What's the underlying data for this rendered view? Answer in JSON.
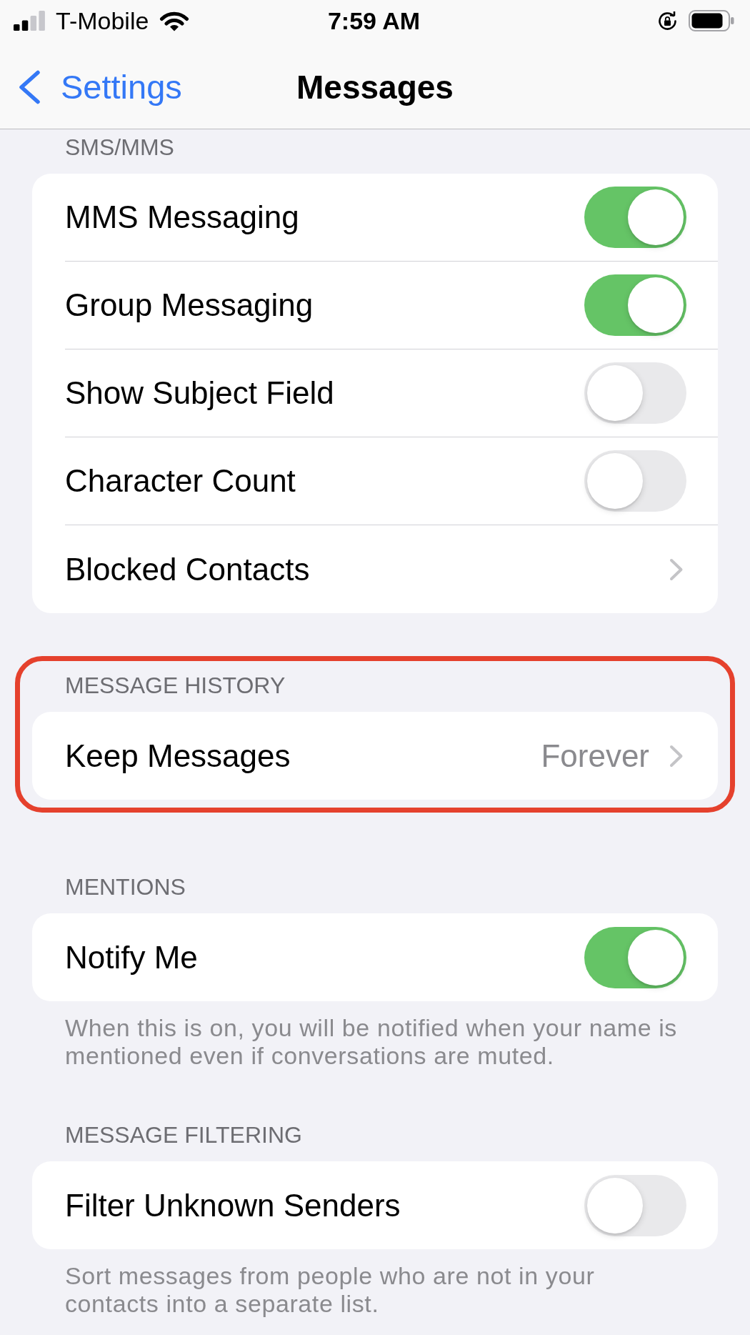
{
  "status_bar": {
    "carrier": "T-Mobile",
    "time": "7:59 AM"
  },
  "nav_bar": {
    "back_label": "Settings",
    "title": "Messages"
  },
  "sections": [
    {
      "header": "SMS/MMS",
      "highlighted": false,
      "rows": [
        {
          "kind": "toggle",
          "label": "MMS Messaging",
          "on": true
        },
        {
          "kind": "toggle",
          "label": "Group Messaging",
          "on": true
        },
        {
          "kind": "toggle",
          "label": "Show Subject Field",
          "on": false
        },
        {
          "kind": "toggle",
          "label": "Character Count",
          "on": false
        },
        {
          "kind": "link",
          "label": "Blocked Contacts"
        }
      ]
    },
    {
      "header": "MESSAGE HISTORY",
      "highlighted": true,
      "rows": [
        {
          "kind": "link",
          "label": "Keep Messages",
          "value": "Forever"
        }
      ]
    },
    {
      "header": "MENTIONS",
      "highlighted": false,
      "rows": [
        {
          "kind": "toggle",
          "label": "Notify Me",
          "on": true
        }
      ],
      "footer": "When this is on, you will be notified when your name is mentioned even if conversations are muted."
    },
    {
      "header": "MESSAGE FILTERING",
      "highlighted": false,
      "rows": [
        {
          "kind": "toggle",
          "label": "Filter Unknown Senders",
          "on": false
        }
      ],
      "footer": "Sort messages from people who are not in your contacts into a separate list."
    }
  ]
}
